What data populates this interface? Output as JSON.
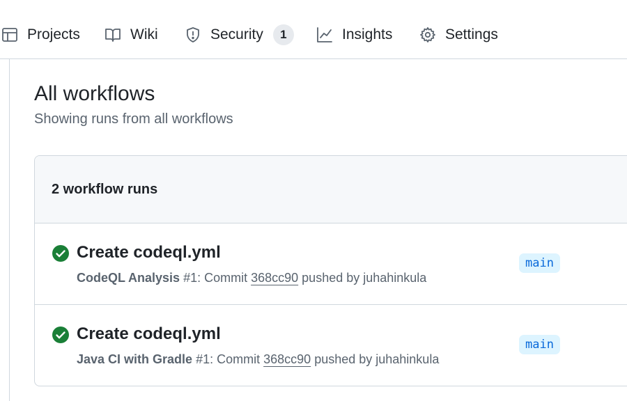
{
  "nav": {
    "items": [
      {
        "label": "Projects",
        "icon": "table-icon"
      },
      {
        "label": "Wiki",
        "icon": "book-icon"
      },
      {
        "label": "Security",
        "icon": "shield-icon",
        "count": "1"
      },
      {
        "label": "Insights",
        "icon": "graph-icon"
      },
      {
        "label": "Settings",
        "icon": "gear-icon"
      }
    ]
  },
  "page": {
    "title": "All workflows",
    "subtitle": "Showing runs from all workflows"
  },
  "runs": {
    "count_label": "2 workflow runs",
    "items": [
      {
        "status": "success",
        "title": "Create codeql.yml",
        "workflow": "CodeQL Analysis",
        "run_number": "#1",
        "commit_prefix": ": Commit ",
        "sha": "368cc90",
        "pushed_by": " pushed by juhahinkula",
        "branch": "main"
      },
      {
        "status": "success",
        "title": "Create codeql.yml",
        "workflow": "Java CI with Gradle",
        "run_number": "#1",
        "commit_prefix": ": Commit ",
        "sha": "368cc90",
        "pushed_by": " pushed by juhahinkula",
        "branch": "main"
      }
    ]
  },
  "colors": {
    "success": "#1a7f37",
    "link": "#0969da",
    "branch_bg": "#ddf4ff"
  }
}
